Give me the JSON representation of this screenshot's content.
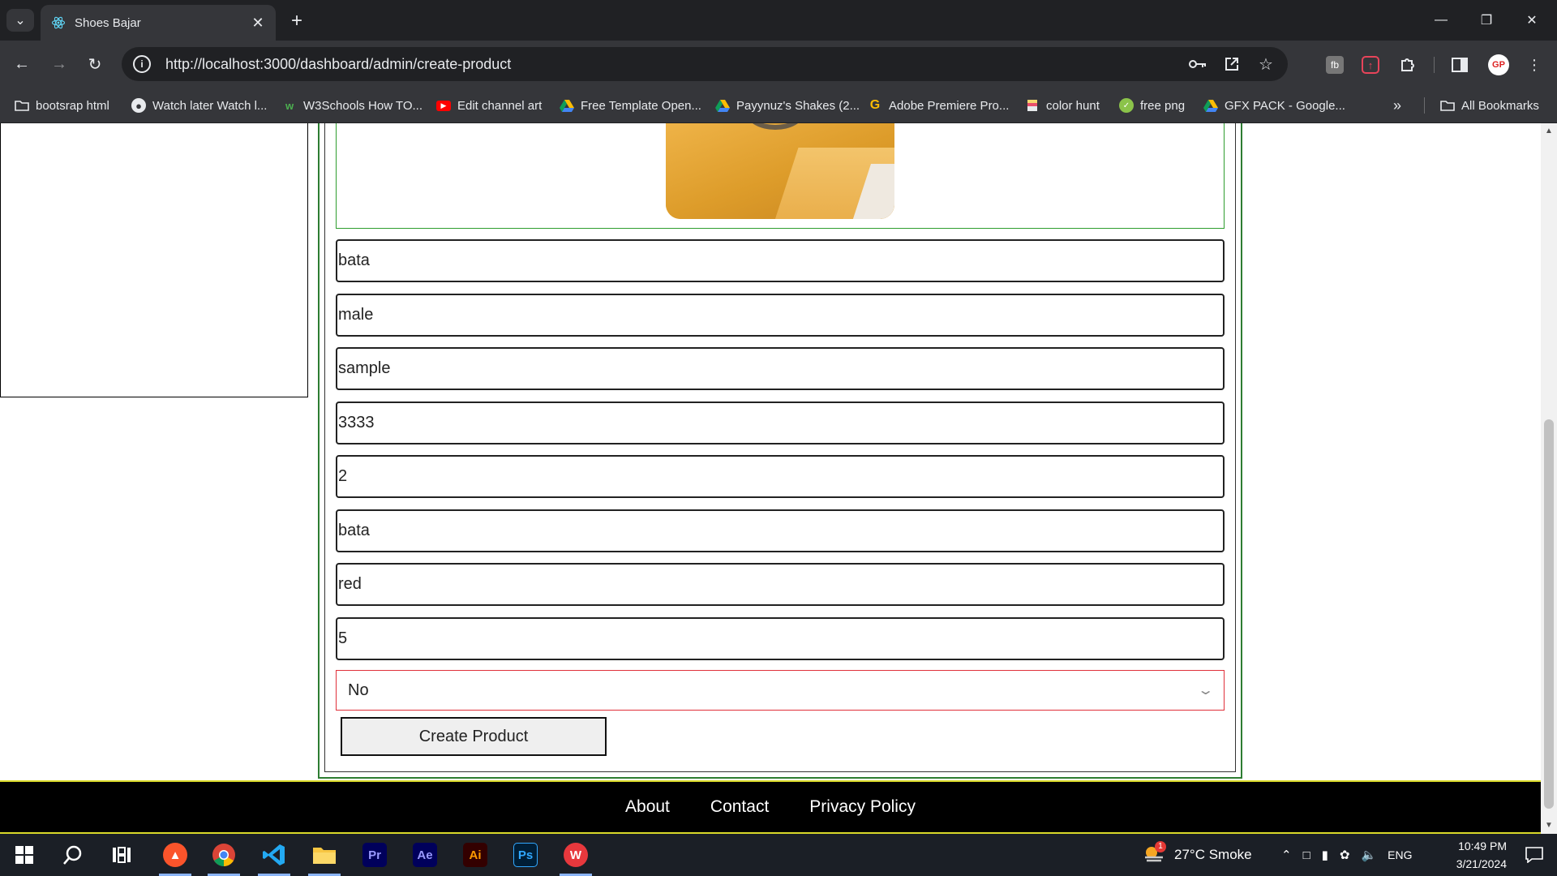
{
  "browser": {
    "tab_title": "Shoes Bajar",
    "url": "http://localhost:3000/dashboard/admin/create-product",
    "bookmarks": [
      {
        "label": "bootsrap html",
        "icon": "folder-icon"
      },
      {
        "label": "Watch later Watch l...",
        "icon": "globe-icon"
      },
      {
        "label": "W3Schools How TO...",
        "icon": "w3schools-icon"
      },
      {
        "label": "Edit channel art",
        "icon": "youtube-icon"
      },
      {
        "label": "Free Template Open...",
        "icon": "google-drive-icon"
      },
      {
        "label": "Payynuz's Shakes (2...",
        "icon": "google-drive-icon"
      },
      {
        "label": "Adobe Premiere Pro...",
        "icon": "g-icon"
      },
      {
        "label": "color hunt",
        "icon": "color-hunt-icon"
      },
      {
        "label": "free png",
        "icon": "free-png-icon"
      },
      {
        "label": "GFX PACK - Google...",
        "icon": "google-drive-icon"
      }
    ],
    "all_bookmarks": "All Bookmarks"
  },
  "form": {
    "fields": [
      "bata",
      "male",
      "sample",
      "3333",
      "2",
      "bata",
      "red",
      "5"
    ],
    "shipping_select": "No",
    "submit_label": "Create Product"
  },
  "footer": {
    "links": [
      "About",
      "Contact",
      "Privacy Policy"
    ]
  },
  "taskbar": {
    "weather": "27°C  Smoke",
    "language": "ENG",
    "time": "10:49 PM",
    "date": "3/21/2024",
    "apps": [
      "Pr",
      "Ae",
      "Ai",
      "Ps"
    ]
  }
}
